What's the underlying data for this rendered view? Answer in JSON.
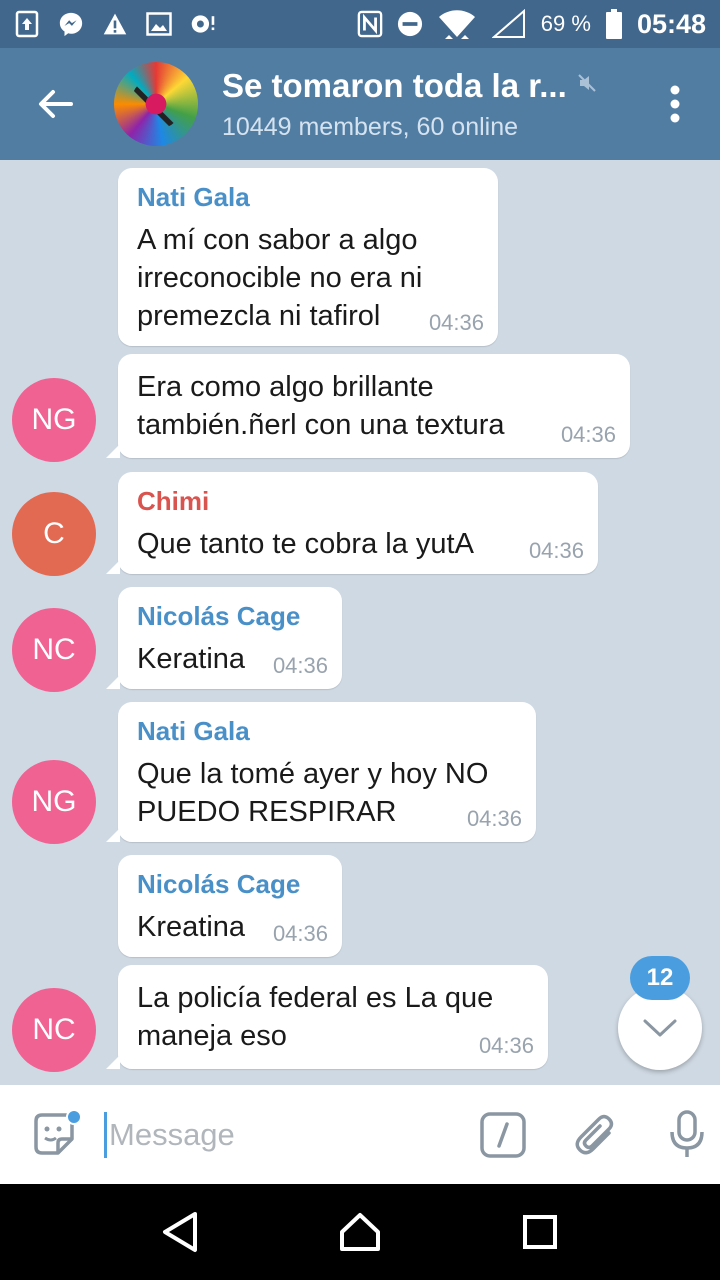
{
  "status_bar": {
    "battery_percent": "69 %",
    "time": "05:48"
  },
  "header": {
    "title": "Se tomaron toda la r...",
    "subtitle": "10449 members, 60 online"
  },
  "messages": [
    {
      "sender": "Nati Gala",
      "sender_color": "#4a90c8",
      "avatar": null,
      "lines": [
        "A mí con sabor a algo",
        "irreconocible no era ni",
        "premezcla ni tafirol"
      ],
      "time": "04:36"
    },
    {
      "sender": "",
      "avatar": "NG",
      "avatar_color": "#f06292",
      "lines": [
        "Era como algo brillante",
        "también.ñerl con una textura"
      ],
      "time": "04:36"
    },
    {
      "sender": "Chimi",
      "sender_color": "#d9534f",
      "avatar": "C",
      "avatar_color": "#e26a52",
      "lines": [
        "Que  tanto te cobra la yutA"
      ],
      "time": "04:36"
    },
    {
      "sender": "Nicolás Cage",
      "sender_color": "#4a90c8",
      "avatar": "NC",
      "avatar_color": "#f06292",
      "lines": [
        "Keratina"
      ],
      "time": "04:36"
    },
    {
      "sender": "Nati Gala",
      "sender_color": "#4a90c8",
      "avatar": "NG",
      "avatar_color": "#f06292",
      "lines": [
        "Que la tomé ayer y hoy NO",
        "PUEDO RESPIRAR"
      ],
      "time": "04:36"
    },
    {
      "sender": "Nicolás Cage",
      "sender_color": "#4a90c8",
      "avatar": null,
      "lines": [
        "Kreatina"
      ],
      "time": "04:36"
    },
    {
      "sender": "",
      "avatar": "NC",
      "avatar_color": "#f06292",
      "lines": [
        "La policía federal es La que",
        "maneja eso"
      ],
      "time": "04:36"
    }
  ],
  "scroll_badge": "12",
  "input": {
    "placeholder": "Message"
  },
  "icons": {
    "status": [
      "upload-icon",
      "messenger-icon",
      "warning-icon",
      "image-icon",
      "record-icon",
      "nfc-icon",
      "dnd-icon",
      "wifi-icon",
      "signal-icon",
      "battery-icon"
    ],
    "header": [
      "back-arrow-icon",
      "mute-icon",
      "more-vert-icon"
    ],
    "input": [
      "sticker-icon",
      "bot-command-icon",
      "attach-icon",
      "mic-icon"
    ],
    "nav": [
      "back-triangle-icon",
      "home-icon",
      "recents-icon"
    ]
  }
}
